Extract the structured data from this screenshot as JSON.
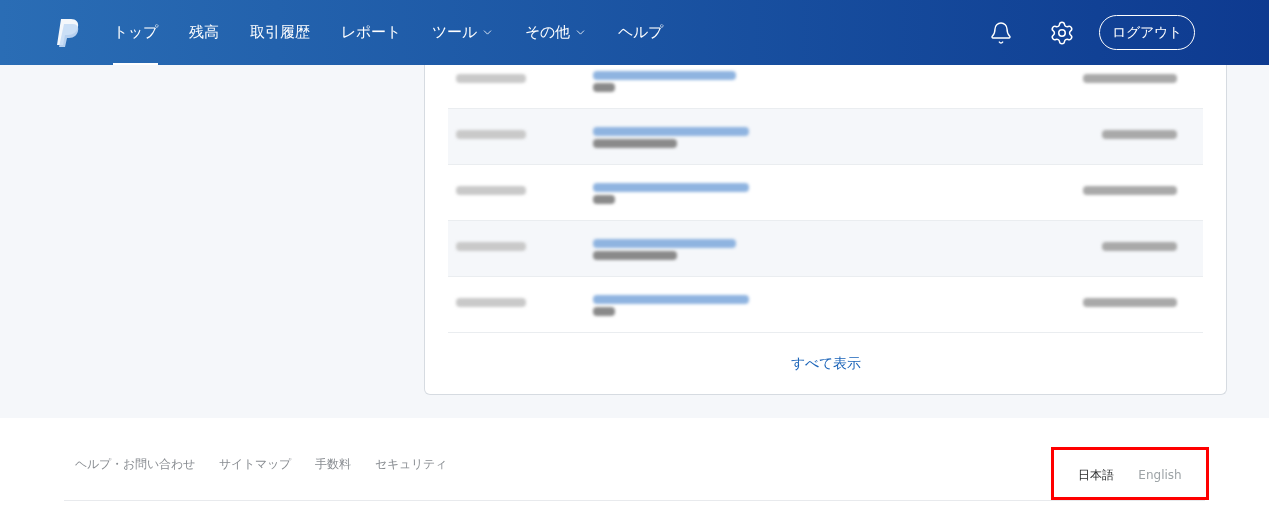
{
  "nav": {
    "items": [
      {
        "label": "トップ",
        "selected": true,
        "dropdown": false
      },
      {
        "label": "残高",
        "selected": false,
        "dropdown": false
      },
      {
        "label": "取引履歴",
        "selected": false,
        "dropdown": false
      },
      {
        "label": "レポート",
        "selected": false,
        "dropdown": false
      },
      {
        "label": "ツール",
        "selected": false,
        "dropdown": true
      },
      {
        "label": "その他",
        "selected": false,
        "dropdown": true
      },
      {
        "label": "ヘルプ",
        "selected": false,
        "dropdown": false
      }
    ],
    "logout": "ログアウト"
  },
  "activity": {
    "rows": [
      {
        "shaded": false,
        "wide_title": false
      },
      {
        "shaded": true,
        "wide_title": true
      },
      {
        "shaded": false,
        "wide_title": true
      },
      {
        "shaded": true,
        "wide_title": false
      },
      {
        "shaded": false,
        "wide_title": true
      }
    ],
    "show_all": "すべて表示"
  },
  "footer": {
    "links": [
      "ヘルプ・お問い合わせ",
      "サイトマップ",
      "手数料",
      "セキュリティ"
    ],
    "languages": [
      {
        "label": "日本語",
        "selected": true
      },
      {
        "label": "English",
        "selected": false
      }
    ],
    "languages_highlighted": true
  }
}
